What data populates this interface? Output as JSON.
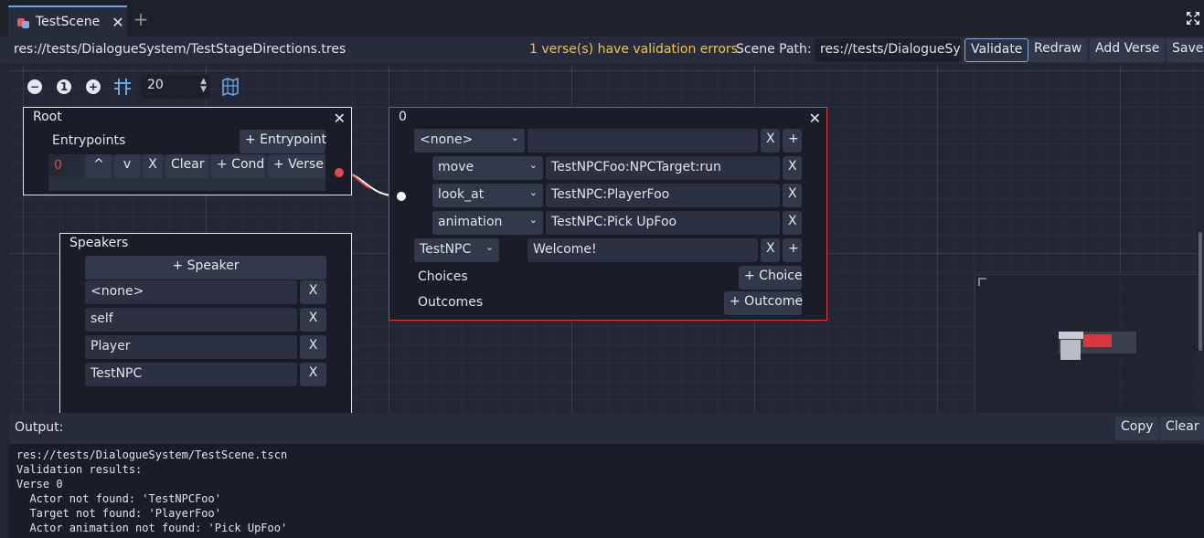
{
  "tab": {
    "title": "TestScene",
    "close": "✕",
    "add": "+"
  },
  "toolbar": {
    "resource_path": "res://tests/DialogueSystem/TestStageDirections.tres",
    "validation_error": "1 verse(s) have validation errors",
    "scene_path_label": "Scene Path:",
    "scene_path_value": "res://tests/DialogueSy",
    "validate": "Validate",
    "redraw": "Redraw",
    "add_verse": "Add Verse",
    "save": "Save"
  },
  "graph": {
    "zoom_out": "−",
    "zoom_reset": "1",
    "zoom_in": "+",
    "snap_value": "20"
  },
  "root_node": {
    "title": "Root",
    "close": "✕",
    "entrypoints_label": "Entrypoints",
    "add_entrypoint": "+ Entrypoint",
    "entry_index": "0",
    "up": "^",
    "down": "v",
    "remove": "X",
    "clear": "Clear",
    "add_cond": "+ Cond",
    "add_verse": "+ Verse"
  },
  "speakers_node": {
    "title": "Speakers",
    "add_speaker": "+ Speaker",
    "remove": "X",
    "speakers": [
      "<none>",
      "self",
      "Player",
      "TestNPC"
    ]
  },
  "verse_node": {
    "title": "0",
    "close": "✕",
    "remove": "X",
    "add": "+",
    "line1_speaker": "<none>",
    "line1_text": "",
    "directions": [
      {
        "type": "move",
        "value": "TestNPCFoo:NPCTarget:run"
      },
      {
        "type": "look_at",
        "value": "TestNPC:PlayerFoo"
      },
      {
        "type": "animation",
        "value": "TestNPC:Pick UpFoo"
      }
    ],
    "line2_speaker": "TestNPC",
    "line2_text": "Welcome!",
    "choices_label": "Choices",
    "add_choice": "+ Choice",
    "outcomes_label": "Outcomes",
    "add_outcome": "+ Outcome"
  },
  "output": {
    "label": "Output:",
    "copy": "Copy",
    "clear": "Clear",
    "lines": "res://tests/DialogueSystem/TestScene.tscn\nValidation results:\nVerse 0\n  Actor not found: 'TestNPCFoo'\n  Target not found: 'PlayerFoo'\n  Actor animation not found: 'Pick UpFoo'"
  },
  "colors": {
    "error": "#d9363e",
    "warning": "#f5c242",
    "accent": "#6ba5e4"
  }
}
